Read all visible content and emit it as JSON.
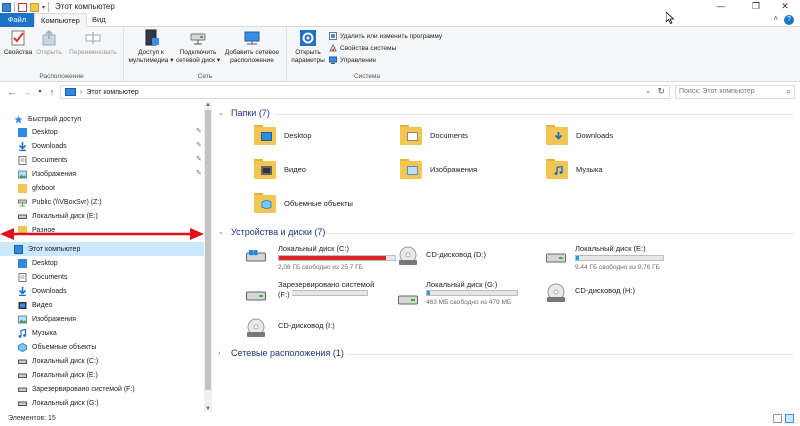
{
  "window": {
    "title": "Этот компьютер"
  },
  "window_controls": {
    "minimize": "—",
    "maximize": "❐",
    "close": "✕"
  },
  "tabs": {
    "file": "Файл",
    "computer": "Компьютер",
    "view": "Вид"
  },
  "ribbon": {
    "properties": "Свойства",
    "open": "Открыть",
    "rename": "Переименовать",
    "group_location": "Расположение",
    "media_access_1": "Доступ к",
    "media_access_2": "мультимедиа ▾",
    "map_drive_1": "Подключить",
    "map_drive_2": "сетевой диск ▾",
    "add_location_1": "Добавить сетевое",
    "add_location_2": "расположение",
    "group_network": "Сеть",
    "open_settings_1": "Открыть",
    "open_settings_2": "параметры",
    "uninstall": "Удалить или изменить программу",
    "system_props": "Свойства системы",
    "manage": "Управление",
    "group_system": "Система"
  },
  "address": {
    "path": "Этот компьютер",
    "search_placeholder": "Поиск: Этот компьютер"
  },
  "nav": {
    "quick_access": "Быстрый доступ",
    "quick_items": [
      "Desktop",
      "Downloads",
      "Documents",
      "Изображения",
      "gfxboot",
      "Public (\\\\VBoxSvr) (Z:)",
      "Локальный диск (E:)",
      "Разное"
    ],
    "this_pc": "Этот компьютер",
    "pc_items": [
      "Desktop",
      "Documents",
      "Downloads",
      "Видео",
      "Изображения",
      "Музыка",
      "Объемные объекты",
      "Локальный диск (C:)",
      "Локальный диск (E:)",
      "Зарезервировано системой (F:)",
      "Локальный диск (G:)"
    ]
  },
  "content": {
    "folders_header": "Папки (7)",
    "folders": [
      "Desktop",
      "Documents",
      "Downloads",
      "Видео",
      "Изображения",
      "Музыка",
      "Объемные объекты"
    ],
    "drives_header": "Устройства и диски (7)",
    "drives": [
      {
        "name": "Локальный диск (C:)",
        "free": "2,08 ГБ свободно из 25,7 ГБ",
        "fill": 0.92
      },
      {
        "name": "CD-дисковод (D:)"
      },
      {
        "name": "Локальный диск (E:)",
        "free": "9,44 ГБ свободно из 9,76 ГБ",
        "fill": 0.03
      },
      {
        "name_1": "Зарезервировано системой",
        "name_2": "(F:)",
        "fill": 0.0
      },
      {
        "name": "Локальный диск (G:)",
        "free": "463 МБ свободно из 479 МБ",
        "fill": 0.03
      },
      {
        "name": "CD-дисковод (H:)"
      },
      {
        "name": "CD-дисковод (I:)"
      }
    ],
    "network_header": "Сетевые расположения (1)"
  },
  "status": {
    "items_count": "Элементов: 15"
  },
  "colors": {
    "accent": "#1a73c9",
    "selection": "#cce8ff",
    "header_text": "#1e3287",
    "annotation_red": "#e0101a"
  }
}
